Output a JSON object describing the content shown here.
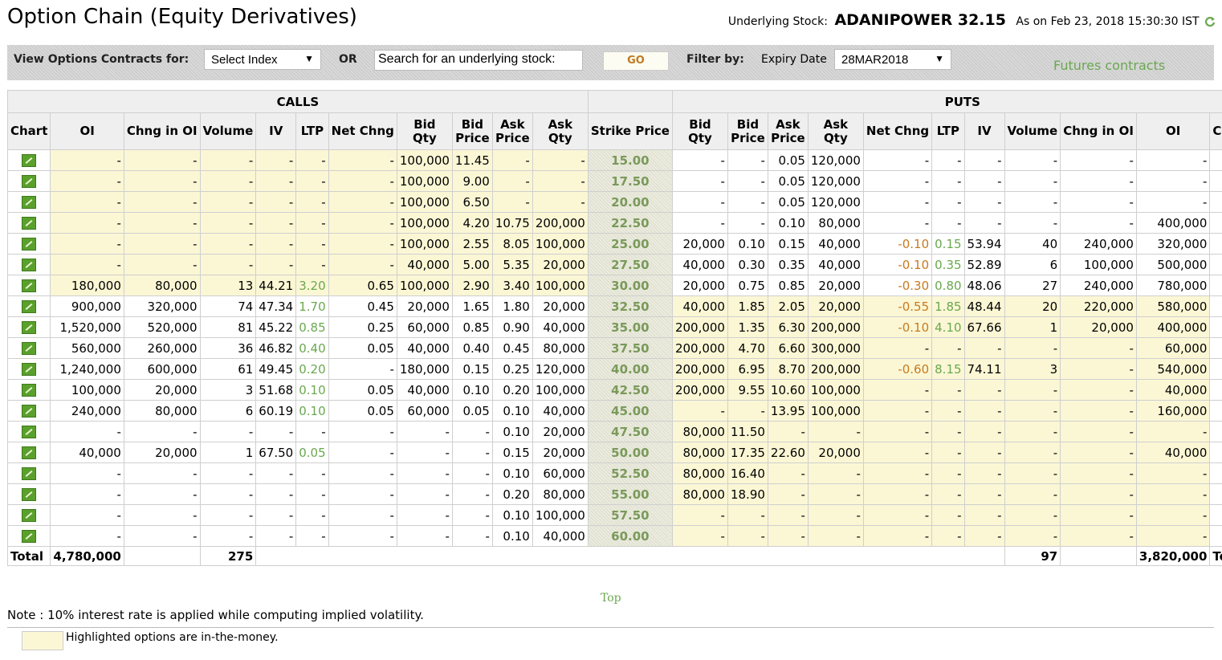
{
  "page": {
    "title": "Option Chain (Equity Derivatives)",
    "underlying_label": "Underlying Stock:",
    "underlying_stock": "ADANIPOWER 32.15",
    "as_on": "As on Feb 23, 2018 15:30:30 IST"
  },
  "toolbar": {
    "view_label": "View Options Contracts for:",
    "index_select": "Select Index",
    "or_label": "OR",
    "search_value": "Search for an underlying stock:",
    "go_label": "GO",
    "filter_label": "Filter by:",
    "expiry_label": "Expiry Date",
    "expiry_select": "28MAR2018",
    "futures_link": "Futures contracts"
  },
  "table": {
    "calls_label": "CALLS",
    "puts_label": "PUTS",
    "headers": [
      "Chart",
      "OI",
      "Chng in OI",
      "Volume",
      "IV",
      "LTP",
      "Net Chng",
      "Bid Qty",
      "Bid Price",
      "Ask Price",
      "Ask Qty",
      "Strike Price",
      "Bid Qty",
      "Bid Price",
      "Ask Price",
      "Ask Qty",
      "Net Chng",
      "LTP",
      "IV",
      "Volume",
      "Chng in OI",
      "OI",
      "Chart"
    ],
    "rows": [
      {
        "strike": "15.00",
        "calls": [
          "-",
          "-",
          "-",
          "-",
          "-",
          "-",
          "100,000",
          "11.45",
          "-",
          "-"
        ],
        "puts": [
          "-",
          "-",
          "0.05",
          "120,000",
          "-",
          "-",
          "-",
          "-",
          "-",
          "-"
        ]
      },
      {
        "strike": "17.50",
        "calls": [
          "-",
          "-",
          "-",
          "-",
          "-",
          "-",
          "100,000",
          "9.00",
          "-",
          "-"
        ],
        "puts": [
          "-",
          "-",
          "0.05",
          "120,000",
          "-",
          "-",
          "-",
          "-",
          "-",
          "-"
        ]
      },
      {
        "strike": "20.00",
        "calls": [
          "-",
          "-",
          "-",
          "-",
          "-",
          "-",
          "100,000",
          "6.50",
          "-",
          "-"
        ],
        "puts": [
          "-",
          "-",
          "0.05",
          "120,000",
          "-",
          "-",
          "-",
          "-",
          "-",
          "-"
        ]
      },
      {
        "strike": "22.50",
        "calls": [
          "-",
          "-",
          "-",
          "-",
          "-",
          "-",
          "100,000",
          "4.20",
          "10.75",
          "200,000"
        ],
        "puts": [
          "-",
          "-",
          "0.10",
          "80,000",
          "-",
          "-",
          "-",
          "-",
          "-",
          "400,000"
        ]
      },
      {
        "strike": "25.00",
        "calls": [
          "-",
          "-",
          "-",
          "-",
          "-",
          "-",
          "100,000",
          "2.55",
          "8.05",
          "100,000"
        ],
        "puts": [
          "20,000",
          "0.10",
          "0.15",
          "40,000",
          "-0.10",
          "0.15",
          "53.94",
          "40",
          "240,000",
          "320,000"
        ]
      },
      {
        "strike": "27.50",
        "calls": [
          "-",
          "-",
          "-",
          "-",
          "-",
          "-",
          "40,000",
          "5.00",
          "5.35",
          "20,000"
        ],
        "puts": [
          "40,000",
          "0.30",
          "0.35",
          "40,000",
          "-0.10",
          "0.35",
          "52.89",
          "6",
          "100,000",
          "500,000"
        ]
      },
      {
        "strike": "30.00",
        "calls": [
          "180,000",
          "80,000",
          "13",
          "44.21",
          "3.20",
          "0.65",
          "100,000",
          "2.90",
          "3.40",
          "100,000"
        ],
        "puts": [
          "20,000",
          "0.75",
          "0.85",
          "20,000",
          "-0.30",
          "0.80",
          "48.06",
          "27",
          "240,000",
          "780,000"
        ]
      },
      {
        "strike": "32.50",
        "calls": [
          "900,000",
          "320,000",
          "74",
          "47.34",
          "1.70",
          "0.45",
          "20,000",
          "1.65",
          "1.80",
          "20,000"
        ],
        "puts": [
          "40,000",
          "1.85",
          "2.05",
          "20,000",
          "-0.55",
          "1.85",
          "48.44",
          "20",
          "220,000",
          "580,000"
        ]
      },
      {
        "strike": "35.00",
        "calls": [
          "1,520,000",
          "520,000",
          "81",
          "45.22",
          "0.85",
          "0.25",
          "60,000",
          "0.85",
          "0.90",
          "40,000"
        ],
        "puts": [
          "200,000",
          "1.35",
          "6.30",
          "200,000",
          "-0.10",
          "4.10",
          "67.66",
          "1",
          "20,000",
          "400,000"
        ]
      },
      {
        "strike": "37.50",
        "calls": [
          "560,000",
          "260,000",
          "36",
          "46.82",
          "0.40",
          "0.05",
          "40,000",
          "0.40",
          "0.45",
          "80,000"
        ],
        "puts": [
          "200,000",
          "4.70",
          "6.60",
          "300,000",
          "-",
          "-",
          "-",
          "-",
          "-",
          "60,000"
        ]
      },
      {
        "strike": "40.00",
        "calls": [
          "1,240,000",
          "600,000",
          "61",
          "49.45",
          "0.20",
          "-",
          "180,000",
          "0.15",
          "0.25",
          "120,000"
        ],
        "puts": [
          "200,000",
          "6.95",
          "8.70",
          "200,000",
          "-0.60",
          "8.15",
          "74.11",
          "3",
          "-",
          "540,000"
        ]
      },
      {
        "strike": "42.50",
        "calls": [
          "100,000",
          "20,000",
          "3",
          "51.68",
          "0.10",
          "0.05",
          "40,000",
          "0.10",
          "0.20",
          "100,000"
        ],
        "puts": [
          "200,000",
          "9.55",
          "10.60",
          "100,000",
          "-",
          "-",
          "-",
          "-",
          "-",
          "40,000"
        ]
      },
      {
        "strike": "45.00",
        "calls": [
          "240,000",
          "80,000",
          "6",
          "60.19",
          "0.10",
          "0.05",
          "60,000",
          "0.05",
          "0.10",
          "40,000"
        ],
        "puts": [
          "-",
          "-",
          "13.95",
          "100,000",
          "-",
          "-",
          "-",
          "-",
          "-",
          "160,000"
        ]
      },
      {
        "strike": "47.50",
        "calls": [
          "-",
          "-",
          "-",
          "-",
          "-",
          "-",
          "-",
          "-",
          "0.10",
          "20,000"
        ],
        "puts": [
          "80,000",
          "11.50",
          "-",
          "-",
          "-",
          "-",
          "-",
          "-",
          "-",
          "-"
        ]
      },
      {
        "strike": "50.00",
        "calls": [
          "40,000",
          "20,000",
          "1",
          "67.50",
          "0.05",
          "-",
          "-",
          "-",
          "0.15",
          "20,000"
        ],
        "puts": [
          "80,000",
          "17.35",
          "22.60",
          "20,000",
          "-",
          "-",
          "-",
          "-",
          "-",
          "40,000"
        ]
      },
      {
        "strike": "52.50",
        "calls": [
          "-",
          "-",
          "-",
          "-",
          "-",
          "-",
          "-",
          "-",
          "0.10",
          "60,000"
        ],
        "puts": [
          "80,000",
          "16.40",
          "-",
          "-",
          "-",
          "-",
          "-",
          "-",
          "-",
          "-"
        ]
      },
      {
        "strike": "55.00",
        "calls": [
          "-",
          "-",
          "-",
          "-",
          "-",
          "-",
          "-",
          "-",
          "0.20",
          "80,000"
        ],
        "puts": [
          "80,000",
          "18.90",
          "-",
          "-",
          "-",
          "-",
          "-",
          "-",
          "-",
          "-"
        ]
      },
      {
        "strike": "57.50",
        "calls": [
          "-",
          "-",
          "-",
          "-",
          "-",
          "-",
          "-",
          "-",
          "0.10",
          "100,000"
        ],
        "puts": [
          "-",
          "-",
          "-",
          "-",
          "-",
          "-",
          "-",
          "-",
          "-",
          "-"
        ]
      },
      {
        "strike": "60.00",
        "calls": [
          "-",
          "-",
          "-",
          "-",
          "-",
          "-",
          "-",
          "-",
          "0.10",
          "40,000"
        ],
        "puts": [
          "-",
          "-",
          "-",
          "-",
          "-",
          "-",
          "-",
          "-",
          "-",
          "-"
        ]
      }
    ],
    "total": {
      "label": "Total",
      "calls_oi": "4,780,000",
      "calls_volume": "275",
      "puts_volume": "97",
      "puts_oi": "3,820,000"
    }
  },
  "footer": {
    "top_link": "Top",
    "note": "Note : 10% interest rate is applied while computing implied volatility.",
    "legend": "Highlighted options are in-the-money."
  },
  "colors": {
    "itm": "#fbf7d5",
    "positive": "#6aa84f",
    "negative": "#c87a1e",
    "strike_text": "#7a9a5a"
  },
  "icons": {
    "chart": "chart-icon",
    "refresh": "refresh-icon",
    "dropdown": "chevron-down-icon"
  }
}
